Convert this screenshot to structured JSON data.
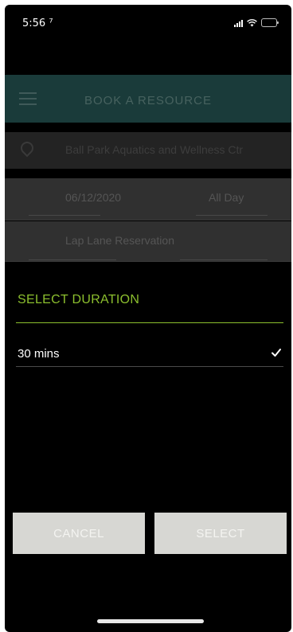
{
  "status_bar": {
    "time": "5:56 ⁷"
  },
  "background": {
    "header_title": "BOOK A RESOURCE",
    "location": "Ball Park Aquatics and Wellness Ctr",
    "date": "06/12/2020",
    "time_period": "All Day",
    "reservation": "Lap Lane Reservation"
  },
  "sheet": {
    "title": "SELECT DURATION",
    "options": [
      {
        "label": "30 mins",
        "selected": true
      }
    ],
    "cancel_label": "CANCEL",
    "select_label": "SELECT"
  },
  "colors": {
    "accent": "#8cbf2e",
    "header_bg": "#1a3b3a",
    "button_bg": "#d7d7d3"
  }
}
